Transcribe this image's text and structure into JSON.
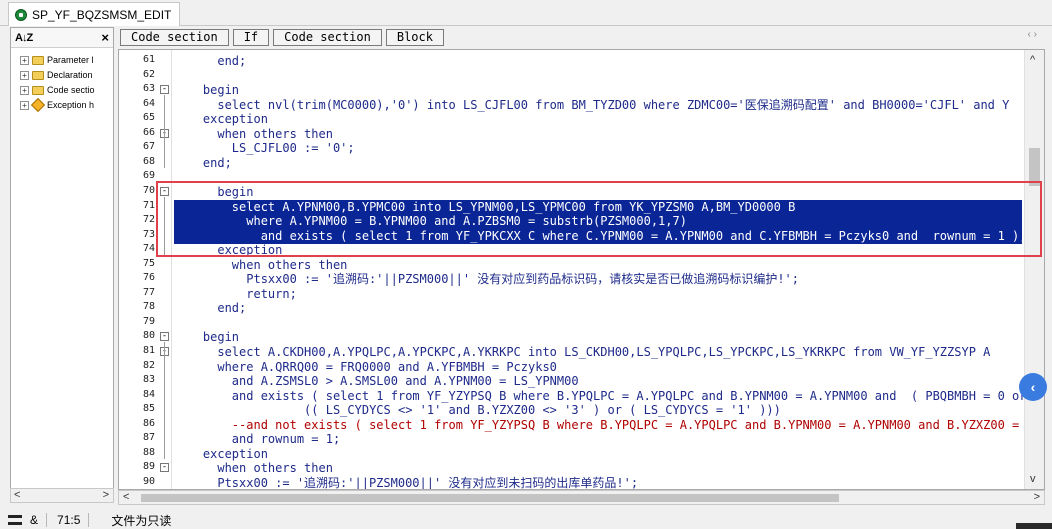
{
  "document_tab": {
    "title": "SP_YF_BQZSMSM_EDIT",
    "icon": "procedure-icon"
  },
  "left_panel": {
    "sort_icon": "A↓Z",
    "close_icon": "×",
    "items": [
      {
        "label": "Parameter l",
        "icon": "folder-icon"
      },
      {
        "label": "Declaration",
        "icon": "folder-icon"
      },
      {
        "label": "Code sectio",
        "icon": "folder-icon"
      },
      {
        "label": "Exception h",
        "icon": "exception-icon"
      }
    ]
  },
  "toolbar": {
    "buttons": [
      "Code section",
      "If",
      "Code section",
      "Block"
    ],
    "nav": "‹ ›"
  },
  "editor": {
    "lines": [
      {
        "n": "61",
        "text": "      end;"
      },
      {
        "n": "62",
        "text": ""
      },
      {
        "n": "63",
        "text": "    begin"
      },
      {
        "n": "64",
        "text": "      select nvl(trim(MC0000),'0') into LS_CJFL00 from BM_TYZD00 where ZDMC00='医保追溯码配置' and BH0000='CJFL' and Y"
      },
      {
        "n": "65",
        "text": "    exception"
      },
      {
        "n": "66",
        "text": "      when others then"
      },
      {
        "n": "67",
        "text": "        LS_CJFL00 := '0';"
      },
      {
        "n": "68",
        "text": "    end;"
      },
      {
        "n": "69",
        "text": ""
      },
      {
        "n": "70",
        "text": "      begin"
      },
      {
        "n": "71",
        "text": "        select A.YPNM00,B.YPMC00 into LS_YPNM00,LS_YPMC00 from YK_YPZSM0 A,BM_YD0000 B"
      },
      {
        "n": "72",
        "text": "          where A.YPNM00 = B.YPNM00 and A.PZBSM0 = substrb(PZSM000,1,7)"
      },
      {
        "n": "73",
        "text": "            and exists ( select 1 from YF_YPKCXX C where C.YPNM00 = A.YPNM00 and C.YFBMBH = Pczyks0 and  rownum = 1 );"
      },
      {
        "n": "74",
        "text": "      exception"
      },
      {
        "n": "75",
        "text": "        when others then"
      },
      {
        "n": "76",
        "text": "          Ptsxx00 := '追溯码:'||PZSM000||' 没有对应到药品标识码，请核实是否已做追溯码标识编护!';"
      },
      {
        "n": "77",
        "text": "          return;"
      },
      {
        "n": "78",
        "text": "      end;"
      },
      {
        "n": "79",
        "text": ""
      },
      {
        "n": "80",
        "text": "    begin"
      },
      {
        "n": "81",
        "text": "      select A.CKDH00,A.YPQLPC,A.YPCKPC,A.YKRKPC into LS_CKDH00,LS_YPQLPC,LS_YPCKPC,LS_YKRKPC from VW_YF_YZZSYP A"
      },
      {
        "n": "82",
        "text": "      where A.QRRQ00 = FRQ0000 and A.YFBMBH = Pczyks0"
      },
      {
        "n": "83",
        "text": "        and A.ZSMSL0 > A.SMSL00 and A.YPNM00 = LS_YPNM00"
      },
      {
        "n": "84",
        "text": "        and exists ( select 1 from YF_YZYPSQ B where B.YPQLPC = A.YPQLPC and B.YPNM00 = A.YPNM00 and  ( PBQBMBH = 0 or"
      },
      {
        "n": "85",
        "text": "                  (( LS_CYDYCS <> '1' and B.YZXZ00 <> '3' ) or ( LS_CYDYCS = '1' )))"
      },
      {
        "n": "86",
        "text": "        --and not exists ( select 1 from YF_YZYPSQ B where B.YPQLPC = A.YPQLPC and B.YPNM00 = A.YPNM00 and B.YZXZ00 ="
      },
      {
        "n": "87",
        "text": "        and rownum = 1;"
      },
      {
        "n": "88",
        "text": "    exception"
      },
      {
        "n": "89",
        "text": "      when others then"
      },
      {
        "n": "90",
        "text": "      Ptsxx00 := '追溯码:'||PZSM000||' 没有对应到未扫码的出库单药品!';"
      }
    ]
  },
  "statusbar": {
    "amp": "&",
    "position": "71:5",
    "readonly": "文件为只读"
  },
  "floating_button": {
    "icon": "chevron-left-icon",
    "glyph": "‹"
  },
  "colors": {
    "selection": "#0a2596",
    "highlight_box": "#e0404a",
    "keyword": "#1a3aa8"
  }
}
